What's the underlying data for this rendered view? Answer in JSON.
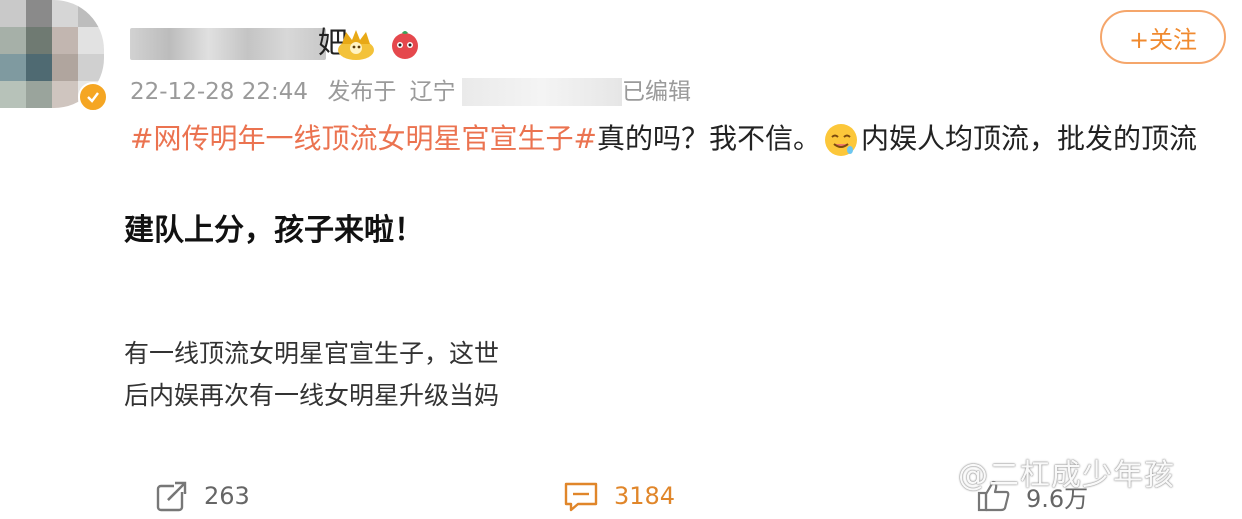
{
  "post": {
    "username_tail": "妑",
    "meta": {
      "timestamp": "22-12-28 22:44",
      "published_at_label": "发布于",
      "location": "辽宁",
      "edited_label": "已编辑"
    },
    "follow_label": "+关注",
    "hashtag": "#网传明年一线顶流女明星官宣生子#",
    "line1_text": "真的吗？我不信。",
    "line1_tail": "内娱人均顶流，批发的顶流",
    "line2": "建队上分，孩子来啦！",
    "line3": "有一线顶流女明星官宣生子，这世",
    "line4": "后内娱再次有一线女明星升级当妈"
  },
  "actions": {
    "repost_count": "263",
    "comment_count": "3184",
    "like_count": "9.6万"
  },
  "watermark": "@二杠成少年孩",
  "colors": {
    "hashtag": "#eb7350",
    "follow": "#f08a2f",
    "meta": "#9a9a9a"
  },
  "icons": {
    "repost": "repost-icon",
    "comment": "comment-icon",
    "like": "thumbs-up-icon"
  }
}
